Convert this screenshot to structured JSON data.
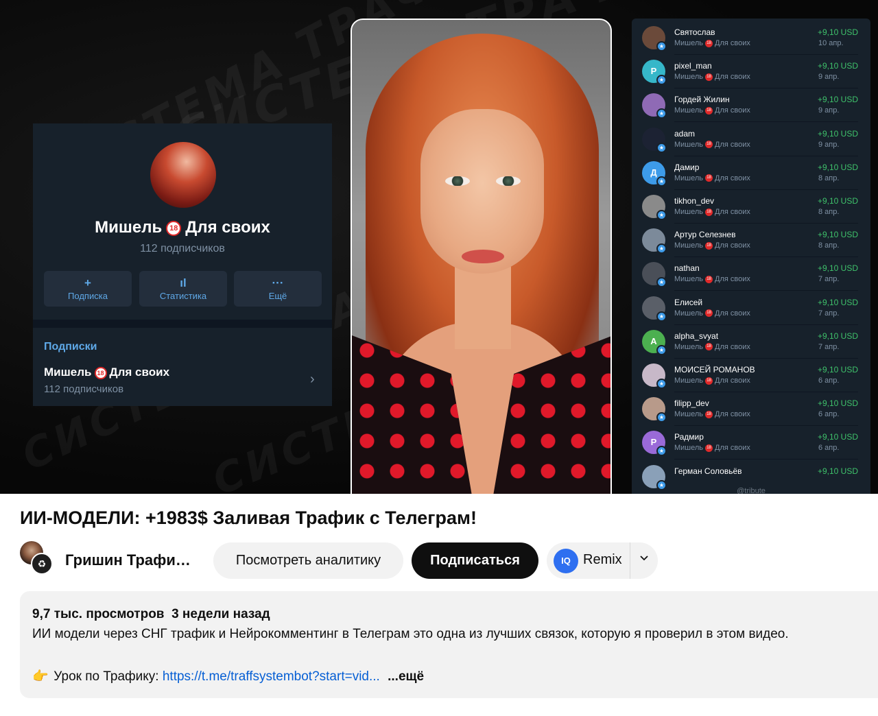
{
  "video": {
    "tg_channel": {
      "name_part1": "Мишель",
      "badge": "18",
      "name_part2": "Для своих",
      "subscribers": "112 подписчиков",
      "buttons": [
        {
          "icon": "+",
          "label": "Подписка"
        },
        {
          "icon": "ıl",
          "label": "Статистика"
        },
        {
          "icon": "···",
          "label": "Ещё"
        }
      ],
      "section_title": "Подписки",
      "row_name_part1": "Мишель",
      "row_name_part2": "Для своих",
      "row_subscribers": "112 подписчиков"
    },
    "tg_payments": {
      "sub_part1": "Мишель",
      "sub_part2": "Для своих",
      "footer": "@tribute",
      "rows": [
        {
          "name": "Святослав",
          "amount": "+9,10 USD",
          "date": "10 апр.",
          "avatar_letter": "",
          "avatar_color": "#6b4a3a"
        },
        {
          "name": "pixel_man",
          "amount": "+9,10 USD",
          "date": "9 апр.",
          "avatar_letter": "P",
          "avatar_color": "#36b7c9"
        },
        {
          "name": "Гордей Жилин",
          "amount": "+9,10 USD",
          "date": "9 апр.",
          "avatar_letter": "",
          "avatar_color": "#8f6ab5"
        },
        {
          "name": "adam",
          "amount": "+9,10 USD",
          "date": "9 апр.",
          "avatar_letter": "",
          "avatar_color": "#1c2233"
        },
        {
          "name": "Дамир",
          "amount": "+9,10 USD",
          "date": "8 апр.",
          "avatar_letter": "Д",
          "avatar_color": "#3d9be9"
        },
        {
          "name": "tikhon_dev",
          "amount": "+9,10 USD",
          "date": "8 апр.",
          "avatar_letter": "",
          "avatar_color": "#8a8a8a"
        },
        {
          "name": "Артур Селезнев",
          "amount": "+9,10 USD",
          "date": "8 апр.",
          "avatar_letter": "",
          "avatar_color": "#7c8a9a"
        },
        {
          "name": "nathan",
          "amount": "+9,10 USD",
          "date": "7 апр.",
          "avatar_letter": "",
          "avatar_color": "#4a4f58"
        },
        {
          "name": "Елисей",
          "amount": "+9,10 USD",
          "date": "7 апр.",
          "avatar_letter": "",
          "avatar_color": "#5a5f68"
        },
        {
          "name": "alpha_svyat",
          "amount": "+9,10 USD",
          "date": "7 апр.",
          "avatar_letter": "A",
          "avatar_color": "#4cb050"
        },
        {
          "name": "МОИСЕЙ РОМАНОВ",
          "amount": "+9,10 USD",
          "date": "6 апр.",
          "avatar_letter": "",
          "avatar_color": "#c7b8c8"
        },
        {
          "name": "filipp_dev",
          "amount": "+9,10 USD",
          "date": "6 апр.",
          "avatar_letter": "",
          "avatar_color": "#b89a8a"
        },
        {
          "name": "Радмир",
          "amount": "+9,10 USD",
          "date": "6 апр.",
          "avatar_letter": "P",
          "avatar_color": "#9a6ad8"
        },
        {
          "name": "Герман Соловьёв",
          "amount": "+9,10 USD",
          "date": "",
          "avatar_letter": "",
          "avatar_color": "#8aa0b8"
        }
      ]
    }
  },
  "title": "ИИ-МОДЕЛИ: +1983$ Заливая Трафик с Телеграм!",
  "channel": {
    "name": "Гришин Трафи…"
  },
  "actions": {
    "analytics_label": "Посмотреть аналитику",
    "subscribe_label": "Подписаться",
    "remix_label": "Remix",
    "remix_icon": "IQ"
  },
  "description": {
    "views": "9,7 тыс. просмотров",
    "age": "3 недели назад",
    "text": "ИИ модели через СНГ трафик и Нейрокомментинг в Телеграм это одна из лучших связок, которую я проверил в этом видео.",
    "link_prefix": "Урок по Трафику: ",
    "link": "https://t.me/traffsystembot?start=vid...",
    "more_label": "...ещё"
  },
  "icons": {
    "pointing_hand": "pointing-hand-icon",
    "chevron": "chevron-down-icon",
    "star": "star-icon"
  },
  "colors": {
    "telegram_bg": "#17212b",
    "telegram_accent": "#5fa9e8",
    "amount_green": "#3fc26b",
    "subscribe_bg": "#0f0f0f",
    "link_blue": "#065fd4"
  }
}
